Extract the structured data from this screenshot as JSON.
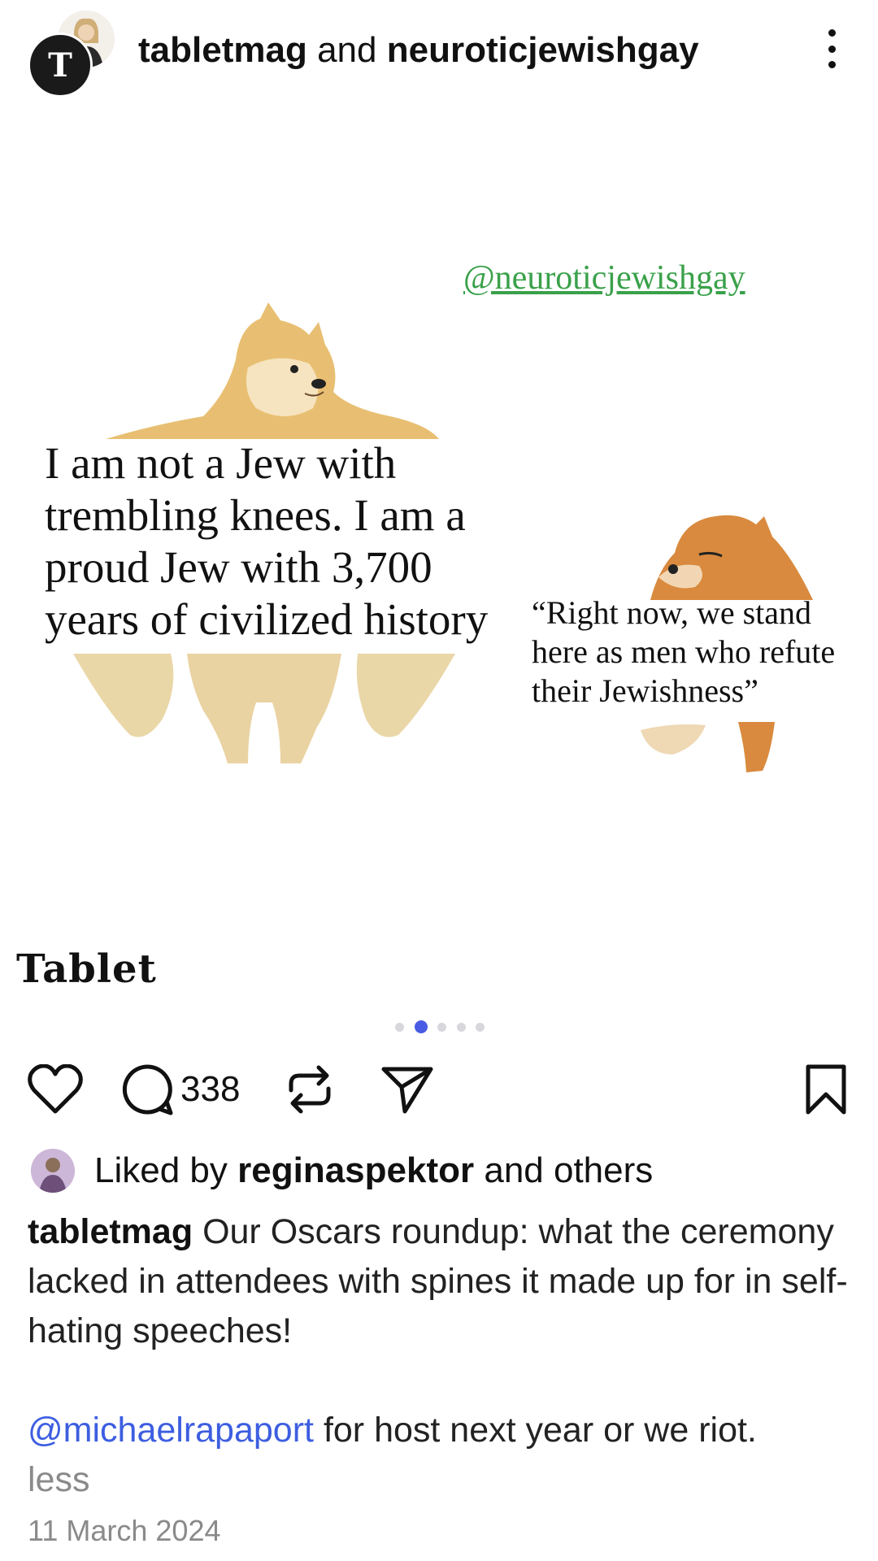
{
  "header": {
    "author_primary": "tabletmag",
    "connector": "and",
    "author_secondary": "neuroticjewishgay",
    "avatar_front_letter": "T"
  },
  "post": {
    "watermark": "@neuroticjewishgay",
    "meme_left_text": "I am not a Jew with trembling knees. I am a proud Jew with 3,700 years of civilized history",
    "meme_right_text": "“Right now, we stand here as men who refute their Jewishness”",
    "brand": "Tablet"
  },
  "carousel": {
    "total": 5,
    "active_index": 1
  },
  "actions": {
    "comment_count": "338"
  },
  "likes": {
    "prefix": "Liked by",
    "user": "reginaspektor",
    "suffix": "and others"
  },
  "caption": {
    "author": "tabletmag",
    "text": "Our Oscars roundup: what the ceremony lacked in attendees with spines it made up for in self-hating speeches!",
    "mention": "@michaelrapaport",
    "text2": "for host next year or we riot.",
    "less": "less"
  },
  "date": "11 March 2024",
  "colors": {
    "accent": "#4a5be3",
    "mention": "#3d5ee0",
    "watermark": "#3aa14a"
  }
}
